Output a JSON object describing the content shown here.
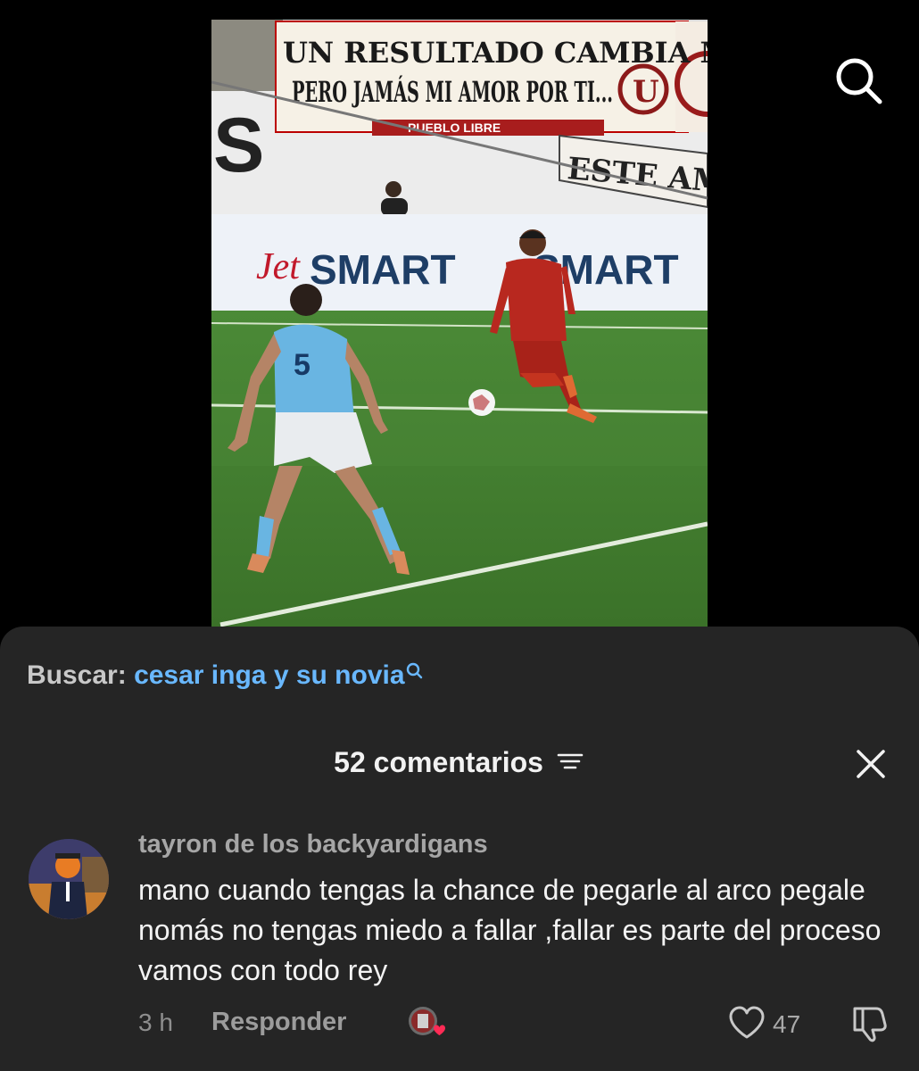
{
  "video": {
    "banner_line1": "UN RESULTADO CAMBIA MI HUMOR,",
    "banner_line2": "PERO JAMÁS MI AMOR POR TI...",
    "banner_sub": "PUEBLO LIBRE",
    "banner_right": "ESTE AMOR",
    "board_brand": "Jet",
    "board_brand2": "SMART",
    "board_brand_b": "SMART",
    "player_blue_number": "5"
  },
  "search": {
    "prefix": "Buscar:",
    "query": "cesar inga y su novia"
  },
  "comments_header": {
    "count_label": "52 comentarios"
  },
  "comment": {
    "username": "tayron de los backyardigans",
    "text": "mano cuando tengas la chance de pegarle al arco pegale nomás no tengas miedo a fallar ,fallar es parte del proceso vamos con todo rey",
    "time": "3 h",
    "reply_label": "Responder",
    "like_count": "47"
  },
  "icons": {
    "top_search": "search-icon",
    "query_search": "search-small-icon",
    "filter": "filter-icon",
    "close": "close-icon",
    "like": "heart-outline-icon",
    "dislike": "thumbs-down-icon",
    "creator_liked": "creator-liked-avatar-icon"
  },
  "colors": {
    "sheet_bg": "#252525",
    "query_link": "#69b8ff",
    "pitch_green": "#3c7a2d"
  }
}
